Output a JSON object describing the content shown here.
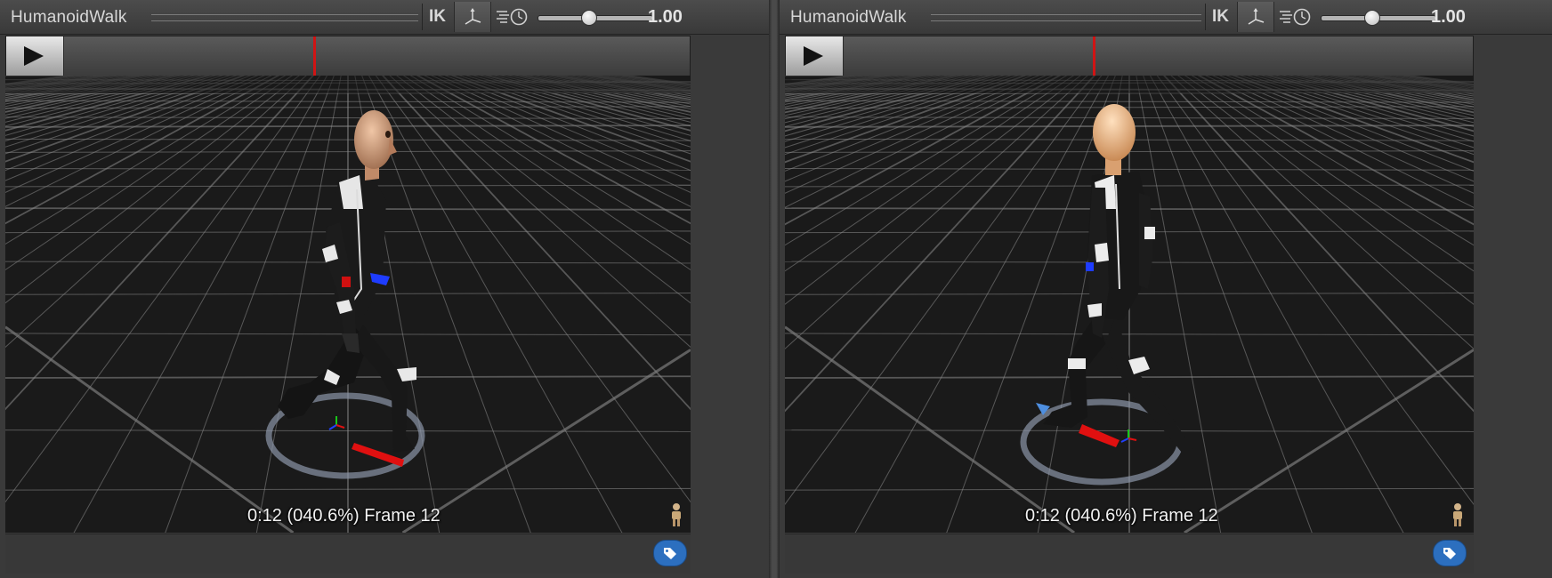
{
  "panels": [
    {
      "clip_name": "HumanoidWalk",
      "ik_label": "IK",
      "speed_value": "1.00",
      "speed_level": 0.45,
      "playhead_position": 0.406,
      "frame_info": "0:12 (040.6%) Frame 12",
      "avatar_icon": "avatar-figure-icon",
      "tag_icon": "tag-icon",
      "character_view": "side-facing-right"
    },
    {
      "clip_name": "HumanoidWalk",
      "ik_label": "IK",
      "speed_value": "1.00",
      "speed_level": 0.45,
      "playhead_position": 0.406,
      "frame_info": "0:12 (040.6%) Frame 12",
      "avatar_icon": "avatar-figure-icon",
      "tag_icon": "tag-icon",
      "character_view": "back-three-quarter"
    }
  ],
  "icons": {
    "play": "play-icon",
    "pivot_gizmo": "pivot-gizmo-icon",
    "speed": "speed-icon"
  },
  "colors": {
    "playhead": "#d01414",
    "tag_button": "#2c6fbf",
    "grid_line": "#8a8a8a",
    "background": "#161616"
  }
}
